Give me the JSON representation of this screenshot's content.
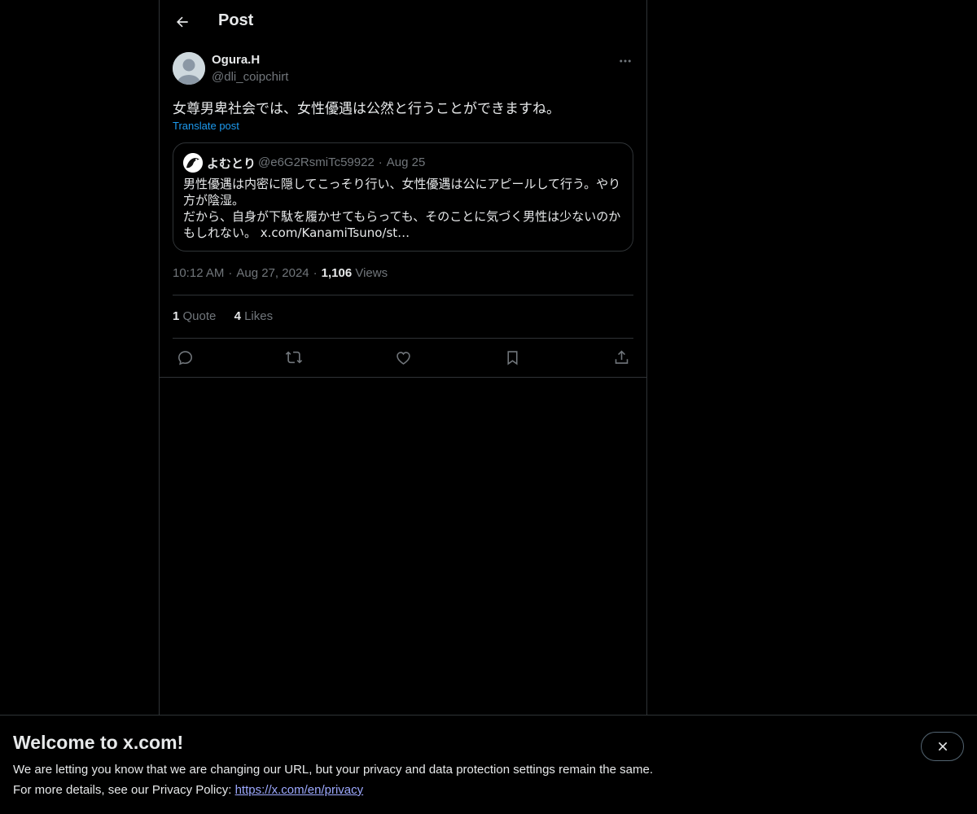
{
  "header": {
    "title": "Post"
  },
  "post": {
    "author_name": "Ogura.H",
    "author_handle": "@dli_coipchirt",
    "text": "女尊男卑社会では、女性優遇は公然と行うことができますね。",
    "translate_label": "Translate post",
    "time": "10:12 AM",
    "date": "Aug 27, 2024",
    "views_count": "1,106",
    "views_label": "Views",
    "quote_count": "1",
    "quote_label": "Quote",
    "likes_count": "4",
    "likes_label": "Likes"
  },
  "quoted": {
    "author_name": "よむとり",
    "author_handle": "@e6G2RsmiTc59922",
    "date": "Aug 25",
    "text": "男性優遇は内密に隠してこっそり行い、女性優遇は公にアピールして行う。やり方が陰湿。\nだから、自身が下駄を履かせてもらっても、そのことに気づく男性は少ないのかもしれない。 x.com/KanamiTsuno/st…"
  },
  "separator": "·",
  "banner": {
    "title": "Welcome to x.com!",
    "line1": "We are letting you know that we are changing our URL, but your privacy and data protection settings remain the same.",
    "line2_prefix": "For more details, see our Privacy Policy: ",
    "link": "https://x.com/en/privacy"
  },
  "icons": {
    "back": "arrow-left-icon",
    "more": "more-horizontal-icon",
    "reply": "reply-icon",
    "repost": "repost-icon",
    "like": "heart-icon",
    "bookmark": "bookmark-icon",
    "share": "share-icon",
    "close": "close-icon"
  },
  "colors": {
    "background": "#000000",
    "border": "#2f3336",
    "text": "#e7e9ea",
    "muted": "#71767b",
    "accent": "#1d9bf0",
    "link": "#9da9ff"
  }
}
